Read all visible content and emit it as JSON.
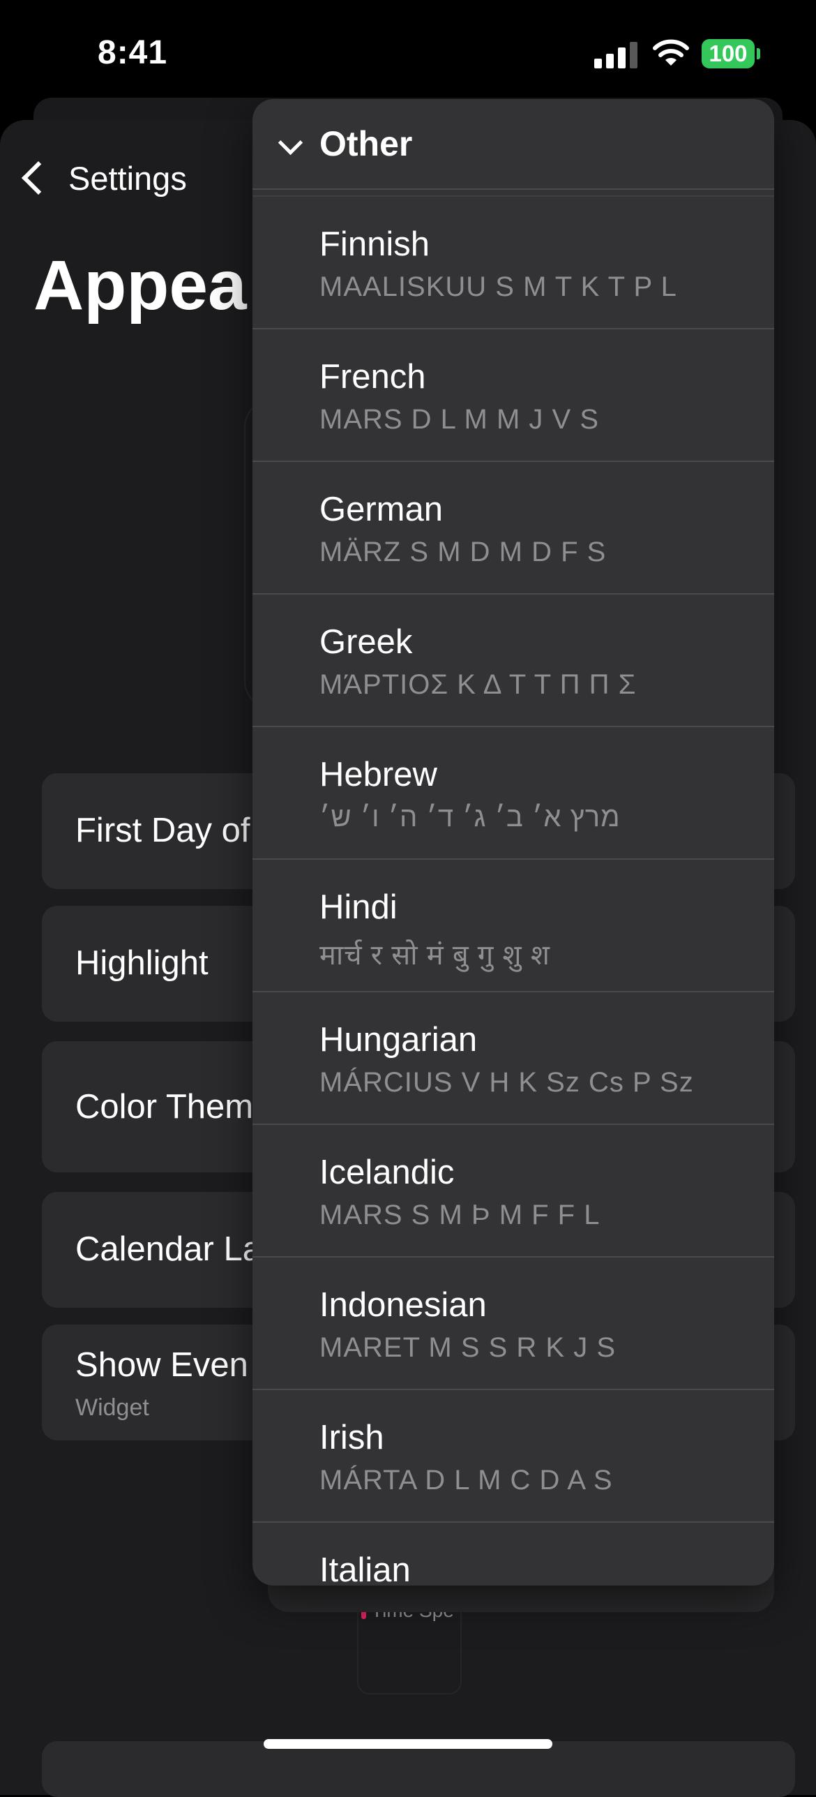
{
  "status_bar": {
    "time": "8:41",
    "battery": "100"
  },
  "nav": {
    "back_label": "Settings"
  },
  "page": {
    "title": "Appea"
  },
  "settings_rows": [
    {
      "label": "First Day of"
    },
    {
      "label": "Highlight"
    },
    {
      "label": "Color Them"
    },
    {
      "label": "Calendar La"
    },
    {
      "label": "Show Even",
      "sublabel": "Widget"
    }
  ],
  "preview": {
    "text": "Time Spe"
  },
  "menu": {
    "header": "Other",
    "items": [
      {
        "name": "Finnish",
        "sample": "MAALISKUU S M T K T P L"
      },
      {
        "name": "French",
        "sample": "MARS D L M M J V S"
      },
      {
        "name": "German",
        "sample": "MÄRZ S M D M D F S"
      },
      {
        "name": "Greek",
        "sample": "ΜΆΡΤΙΟΣ Κ Δ Τ Τ Π Π Σ"
      },
      {
        "name": "Hebrew",
        "sample": "מרץ א׳ ב׳ ג׳ ד׳ ה׳ ו׳ ש׳"
      },
      {
        "name": "Hindi",
        "sample": "मार्च र सो मं बु गु शु श"
      },
      {
        "name": "Hungarian",
        "sample": "MÁRCIUS V H K Sz Cs P Sz"
      },
      {
        "name": "Icelandic",
        "sample": "MARS S M Þ M F F L"
      },
      {
        "name": "Indonesian",
        "sample": "MARET M S S R K J S"
      },
      {
        "name": "Irish",
        "sample": "MÁRTA D L M C D A S"
      },
      {
        "name": "Italian",
        "sample": ""
      }
    ]
  },
  "colors": {
    "background": "#000000",
    "sheet": "#1c1c1e",
    "menu": "#333336",
    "battery": "#34c759",
    "secondary_text": "#8e8e93"
  }
}
